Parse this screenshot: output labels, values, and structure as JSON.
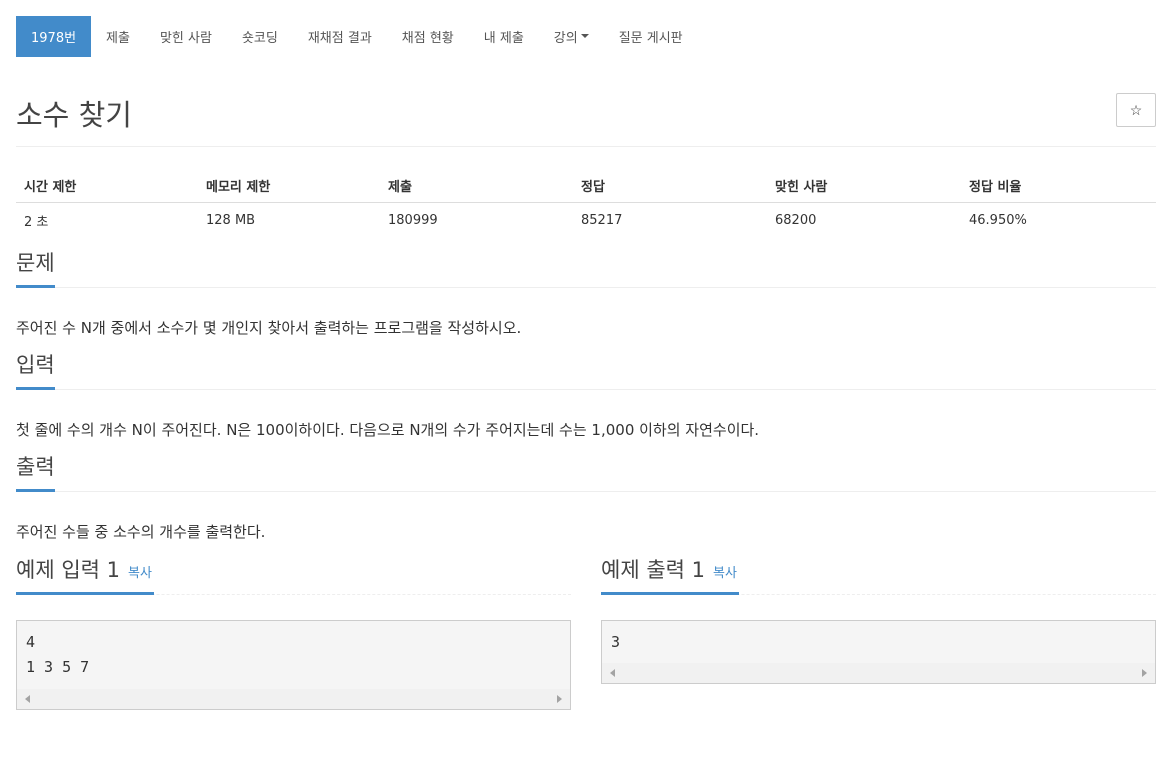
{
  "nav": {
    "items": [
      {
        "label": "1978번",
        "active": true
      },
      {
        "label": "제출"
      },
      {
        "label": "맞힌 사람"
      },
      {
        "label": "숏코딩"
      },
      {
        "label": "재채점 결과"
      },
      {
        "label": "채점 현황"
      },
      {
        "label": "내 제출"
      },
      {
        "label": "강의",
        "dropdown": true
      },
      {
        "label": "질문 게시판"
      }
    ]
  },
  "problem": {
    "title": "소수 찾기",
    "star_icon": "☆"
  },
  "info": {
    "headers": [
      "시간 제한",
      "메모리 제한",
      "제출",
      "정답",
      "맞힌 사람",
      "정답 비율"
    ],
    "values": [
      "2 초",
      "128 MB",
      "180999",
      "85217",
      "68200",
      "46.950%"
    ]
  },
  "sections": {
    "problem": {
      "heading": "문제",
      "text": "주어진 수 N개 중에서 소수가 몇 개인지 찾아서 출력하는 프로그램을 작성하시오."
    },
    "input": {
      "heading": "입력",
      "text": "첫 줄에 수의 개수 N이 주어진다. N은 100이하이다. 다음으로 N개의 수가 주어지는데 수는 1,000 이하의 자연수이다."
    },
    "output": {
      "heading": "출력",
      "text": "주어진 수들 중 소수의 개수를 출력한다."
    }
  },
  "samples": {
    "input": {
      "heading": "예제 입력 1",
      "copy": "복사",
      "content": "4\n1 3 5 7"
    },
    "output": {
      "heading": "예제 출력 1",
      "copy": "복사",
      "content": "3"
    }
  },
  "colors": {
    "accent": "#428bca"
  }
}
